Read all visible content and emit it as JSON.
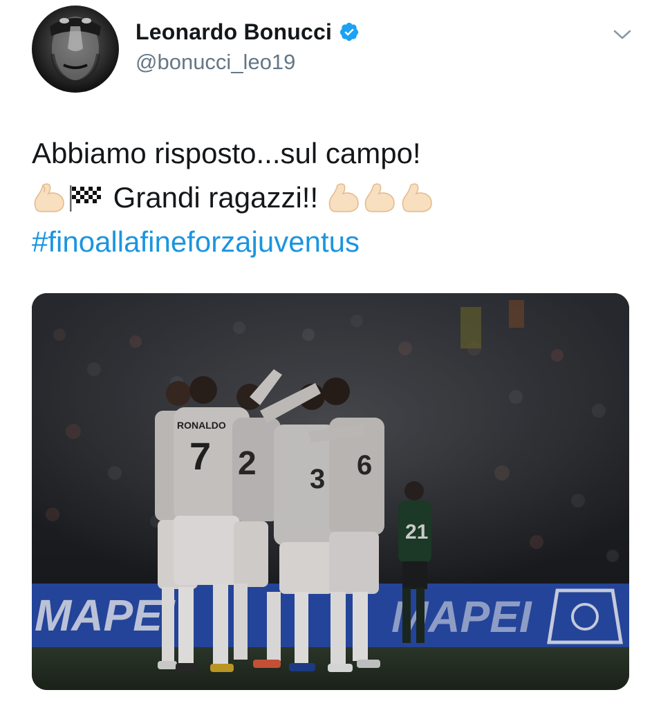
{
  "tweet": {
    "author": {
      "display_name": "Leonardo Bonucci",
      "handle": "@bonucci_leo19",
      "verified": true
    },
    "text_line_1": "Abbiamo risposto...sul campo!",
    "text_line_2_middle": "Grandi ragazzi!!",
    "hashtag": "#finoallafineforzajuventus",
    "media": {
      "board_text_left": "MAPEI",
      "board_text_right": "MAPEI",
      "jersey_names": [
        "RONALDO"
      ],
      "jersey_numbers": [
        "7",
        "2",
        "6",
        "3",
        "21"
      ]
    }
  },
  "colors": {
    "link": "#1b95e0",
    "verified": "#1da1f2",
    "secondary_text": "#657786",
    "primary_text": "#14171a"
  },
  "icons": {
    "verified": "verified-badge-icon",
    "menu": "chevron-down-icon",
    "flexed_biceps": "flexed-biceps-emoji",
    "checkered_flag": "checkered-flag-emoji"
  }
}
